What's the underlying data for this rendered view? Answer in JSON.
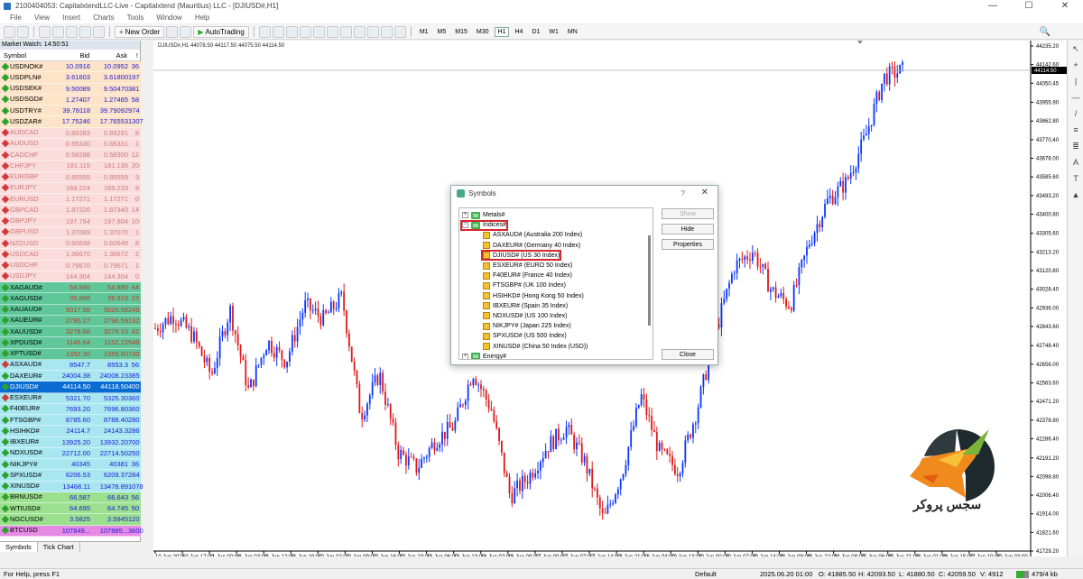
{
  "window": {
    "title": "2100404053: CapitalxtendLLC-Live - Capitalxtend (Mauritius) LLC - [DJIUSD#,H1]",
    "min": "—",
    "max": "☐",
    "close": "✕"
  },
  "menu": [
    "File",
    "View",
    "Insert",
    "Charts",
    "Tools",
    "Window",
    "Help"
  ],
  "toolbar": {
    "new_order": "New Order",
    "autotrading": "AutoTrading",
    "timeframes": [
      "M1",
      "M5",
      "M15",
      "M30",
      "H1",
      "H4",
      "D1",
      "W1",
      "MN"
    ],
    "active_timeframe": "H1"
  },
  "market_watch": {
    "title": "Market Watch: 14:50:51",
    "headers": {
      "symbol": "Symbol",
      "bid": "Bid",
      "ask": "Ask",
      "spread": "!"
    },
    "rows": [
      {
        "symbol": "USDNOK#",
        "bid": "10.0916",
        "ask": "10.0952",
        "spread": "36",
        "bg": "#fde3c8",
        "dir": "up",
        "faded": false
      },
      {
        "symbol": "USDPLN#",
        "bid": "3.61603",
        "ask": "3.61800",
        "spread": "197",
        "bg": "#fde3c8",
        "dir": "up",
        "faded": false
      },
      {
        "symbol": "USDSEK#",
        "bid": "9.50089",
        "ask": "9.50470",
        "spread": "381",
        "bg": "#fde3c8",
        "dir": "up",
        "faded": false
      },
      {
        "symbol": "USDSGD#",
        "bid": "1.27407",
        "ask": "1.27465",
        "spread": "58",
        "bg": "#fde3c8",
        "dir": "up",
        "faded": false
      },
      {
        "symbol": "USDTRY#",
        "bid": "39.78118",
        "ask": "39.79092",
        "spread": "974",
        "bg": "#fde3c8",
        "dir": "up",
        "faded": false
      },
      {
        "symbol": "USDZAR#",
        "bid": "17.75246",
        "ask": "17.76553",
        "spread": "1307",
        "bg": "#fde3c8",
        "dir": "up",
        "faded": false
      },
      {
        "symbol": "AUDCAD",
        "bid": "0.89283",
        "ask": "0.89291",
        "spread": "8",
        "bg": "#fbdcdc",
        "dir": "down",
        "faded": true
      },
      {
        "symbol": "AUDUSD",
        "bid": "0.65330",
        "ask": "0.65331",
        "spread": "1",
        "bg": "#fbdcdc",
        "dir": "down",
        "faded": true
      },
      {
        "symbol": "CADCHF",
        "bid": "0.58288",
        "ask": "0.58300",
        "spread": "12",
        "bg": "#fbdcdc",
        "dir": "down",
        "faded": true
      },
      {
        "symbol": "CHFJPY",
        "bid": "181.115",
        "ask": "181.135",
        "spread": "20",
        "bg": "#fbdcdc",
        "dir": "down",
        "faded": true
      },
      {
        "symbol": "EURGBP",
        "bid": "0.85556",
        "ask": "0.85559",
        "spread": "3",
        "bg": "#fbdcdc",
        "dir": "down",
        "faded": true
      },
      {
        "symbol": "EURJPY",
        "bid": "169.224",
        "ask": "169.233",
        "spread": "9",
        "bg": "#fbdcdc",
        "dir": "down",
        "faded": true
      },
      {
        "symbol": "EURUSD",
        "bid": "1.17271",
        "ask": "1.17271",
        "spread": "0",
        "bg": "#fbdcdc",
        "dir": "down",
        "faded": true
      },
      {
        "symbol": "GBPCAD",
        "bid": "1.87326",
        "ask": "1.87340",
        "spread": "14",
        "bg": "#fbdcdc",
        "dir": "down",
        "faded": true
      },
      {
        "symbol": "GBPJPY",
        "bid": "197.794",
        "ask": "197.804",
        "spread": "10",
        "bg": "#fbdcdc",
        "dir": "down",
        "faded": true
      },
      {
        "symbol": "GBPUSD",
        "bid": "1.37069",
        "ask": "1.37070",
        "spread": "1",
        "bg": "#fbdcdc",
        "dir": "down",
        "faded": true
      },
      {
        "symbol": "NZDUSD",
        "bid": "0.60638",
        "ask": "0.60646",
        "spread": "8",
        "bg": "#fbdcdc",
        "dir": "down",
        "faded": true
      },
      {
        "symbol": "USDCAD",
        "bid": "1.36670",
        "ask": "1.36672",
        "spread": "2",
        "bg": "#fbdcdc",
        "dir": "down",
        "faded": true
      },
      {
        "symbol": "USDCHF",
        "bid": "0.79670",
        "ask": "0.79671",
        "spread": "1",
        "bg": "#fbdcdc",
        "dir": "down",
        "faded": true
      },
      {
        "symbol": "USDJPY",
        "bid": "144.304",
        "ask": "144.304",
        "spread": "0",
        "bg": "#fbdcdc",
        "dir": "down",
        "faded": true
      },
      {
        "symbol": "XAGAUD#",
        "bid": "54.946",
        "ask": "54.990",
        "spread": "44",
        "bg": "#5fc79a",
        "dir": "up",
        "faded": false
      },
      {
        "symbol": "XAGUSD#",
        "bid": "35.896",
        "ask": "35.919",
        "spread": "23",
        "bg": "#5fc79a",
        "dir": "up",
        "faded": false
      },
      {
        "symbol": "XAUAUD#",
        "bid": "5017.58",
        "ask": "5020.06",
        "spread": "248",
        "bg": "#5fc79a",
        "dir": "up",
        "faded": false
      },
      {
        "symbol": "XAUEUR#",
        "bid": "2795.27",
        "ask": "2796.59",
        "spread": "132",
        "bg": "#5fc79a",
        "dir": "up",
        "faded": false
      },
      {
        "symbol": "XAUUSD#",
        "bid": "3278.68",
        "ask": "3279.10",
        "spread": "42",
        "bg": "#5fc79a",
        "dir": "up",
        "faded": false
      },
      {
        "symbol": "XPDUSD#",
        "bid": "1146.64",
        "ask": "1152.12",
        "spread": "548",
        "bg": "#5fc79a",
        "dir": "up",
        "faded": false
      },
      {
        "symbol": "XPTUSD#",
        "bid": "1352.30",
        "ask": "1359.60",
        "spread": "730",
        "bg": "#5fc79a",
        "dir": "up",
        "faded": false
      },
      {
        "symbol": "ASXAUD#",
        "bid": "8547.7",
        "ask": "8553.3",
        "spread": "56",
        "bg": "#a8e6f0",
        "dir": "down",
        "faded": false
      },
      {
        "symbol": "DAXEUR#",
        "bid": "24004.38",
        "ask": "24008.23",
        "spread": "385",
        "bg": "#a8e6f0",
        "dir": "up",
        "faded": false
      },
      {
        "symbol": "DJIUSD#",
        "bid": "44114.50",
        "ask": "44118.50",
        "spread": "400",
        "bg": "#0a6bd0",
        "dir": "up",
        "faded": false,
        "selected": true
      },
      {
        "symbol": "ESXEUR#",
        "bid": "5321.70",
        "ask": "5325.30",
        "spread": "360",
        "bg": "#a8e6f0",
        "dir": "down",
        "faded": false
      },
      {
        "symbol": "F40EUR#",
        "bid": "7693.20",
        "ask": "7696.80",
        "spread": "360",
        "bg": "#a8e6f0",
        "dir": "up",
        "faded": false
      },
      {
        "symbol": "FTSGBP#",
        "bid": "8785.60",
        "ask": "8788.40",
        "spread": "280",
        "bg": "#a8e6f0",
        "dir": "up",
        "faded": false
      },
      {
        "symbol": "HSIHKD#",
        "bid": "24114.7",
        "ask": "24143.3",
        "spread": "286",
        "bg": "#a8e6f0",
        "dir": "up",
        "faded": false
      },
      {
        "symbol": "IBXEUR#",
        "bid": "13925.20",
        "ask": "13932.20",
        "spread": "700",
        "bg": "#a8e6f0",
        "dir": "up",
        "faded": false
      },
      {
        "symbol": "NDXUSD#",
        "bid": "22712.00",
        "ask": "22714.50",
        "spread": "250",
        "bg": "#a8e6f0",
        "dir": "up",
        "faded": false
      },
      {
        "symbol": "NIKJPY#",
        "bid": "40345",
        "ask": "40381",
        "spread": "36",
        "bg": "#a8e6f0",
        "dir": "up",
        "faded": false
      },
      {
        "symbol": "SPXUSD#",
        "bid": "6206.53",
        "ask": "6209.37",
        "spread": "284",
        "bg": "#a8e6f0",
        "dir": "up",
        "faded": false
      },
      {
        "symbol": "XINUSD#",
        "bid": "13468.11",
        "ask": "13478.89",
        "spread": "1078",
        "bg": "#a8e6f0",
        "dir": "up",
        "faded": false
      },
      {
        "symbol": "BRNUSD#",
        "bid": "66.587",
        "ask": "66.643",
        "spread": "56",
        "bg": "#9be08f",
        "dir": "up",
        "faded": false
      },
      {
        "symbol": "WTIUSD#",
        "bid": "64.695",
        "ask": "64.745",
        "spread": "50",
        "bg": "#9be08f",
        "dir": "up",
        "faded": false
      },
      {
        "symbol": "NGCUSD#",
        "bid": "3.5825",
        "ask": "3.5945",
        "spread": "120",
        "bg": "#9be08f",
        "dir": "up",
        "faded": false
      },
      {
        "symbol": "BTCUSD",
        "bid": "107849...",
        "ask": "107885...",
        "spread": "3600",
        "bg": "#e78ae4",
        "dir": "up",
        "faded": false
      }
    ],
    "tabs": [
      "Symbols",
      "Tick Chart"
    ]
  },
  "chart": {
    "header": "DJIUSD#,H1  44078.50 44117.50 44075.50 44114.50",
    "current_price": "44114.50"
  },
  "chart_data": {
    "type": "candlestick",
    "symbol": "DJIUSD#",
    "timeframe": "H1",
    "ylim": [
      41729.2,
      44235.2
    ],
    "y_ticks": [
      "44235.20",
      "44142.60",
      "44050.45",
      "43955.90",
      "43862.80",
      "43770.40",
      "43678.00",
      "43585.60",
      "43493.20",
      "43400.80",
      "43305.60",
      "43213.20",
      "43120.80",
      "43028.40",
      "42936.00",
      "42843.60",
      "42748.40",
      "42656.00",
      "42563.60",
      "42471.20",
      "42378.80",
      "42286.40",
      "42191.20",
      "42098.80",
      "42006.40",
      "41914.00",
      "41821.60",
      "41729.20"
    ],
    "x_ticks": [
      "10 Jun 2025",
      "10 Jun 17:00",
      "11 Jun 00:00",
      "11 Jun 03:00",
      "11 Jun 12:00",
      "11 Jun 19:00",
      "12 Jun 02:00",
      "12 Jun 09:00",
      "12 Jun 16:00",
      "12 Jun 23:00",
      "13 Jun 06:00",
      "13 Jun 13:00",
      "16 Jun 02:00",
      "16 Jun 09:00",
      "17 Jun 00:00",
      "17 Jun 07:00",
      "17 Jun 14:00",
      "18 Jun 21:00",
      "18 Jun 04:00",
      "19 Jun 13:00",
      "20 Jun 00:00",
      "20 Jun 07:00",
      "20 Jun 14:00",
      "23 Jun 09:00",
      "23 Jun 22:00",
      "24 Jun 08:00",
      "25 Jun 06:00",
      "25 Jun 21:00",
      "26 Jun 01:00",
      "26 Jun 15:00",
      "27 Jun 10:00",
      "30 Jun 03:00"
    ],
    "anchors": [
      42835,
      42900,
      42800,
      42600,
      42930,
      42520,
      42770,
      42670,
      42950,
      42880,
      42990,
      42400,
      42610,
      42220,
      42140,
      42280,
      42350,
      42620,
      42430,
      42000,
      42100,
      42250,
      42340,
      42170,
      41880,
      42120,
      42500,
      42220,
      42130,
      42430,
      42820,
      43140,
      43220,
      43020,
      42950,
      43260,
      43470,
      43560,
      43780,
      44080,
      44115
    ],
    "series_colors": {
      "bull": "#0a35ff",
      "bear": "#e01818"
    }
  },
  "dialog": {
    "title": "Symbols",
    "help": "?",
    "close_x": "✕",
    "tree": [
      {
        "label": "Metals#",
        "type": "folder",
        "expanded": false,
        "highlight": false
      },
      {
        "label": "Indices#",
        "type": "folder",
        "expanded": true,
        "highlight": true
      },
      {
        "label": "ASXAUD#  (Australia 200 Index)",
        "type": "leaf",
        "highlight": false
      },
      {
        "label": "DAXEUR#  (Germany 40 Index)",
        "type": "leaf",
        "highlight": false
      },
      {
        "label": "DJIUSD#  (US 30 Index)",
        "type": "leaf",
        "highlight": true
      },
      {
        "label": "ESXEUR#  (EURO 50 Index)",
        "type": "leaf",
        "highlight": false
      },
      {
        "label": "F40EUR#  (France 40 Index)",
        "type": "leaf",
        "highlight": false
      },
      {
        "label": "FTSGBP#  (UK 100 Index)",
        "type": "leaf",
        "highlight": false
      },
      {
        "label": "HSIHKD#  (Hong Kong 50 Index)",
        "type": "leaf",
        "highlight": false
      },
      {
        "label": "IBXEUR#  (Spain 35 Index)",
        "type": "leaf",
        "highlight": false
      },
      {
        "label": "NDXUSD#  (US 100 Index)",
        "type": "leaf",
        "highlight": false
      },
      {
        "label": "NIKJPY#  (Japan 225 Index)",
        "type": "leaf",
        "highlight": false
      },
      {
        "label": "SPXUSD#  (US 500 Index)",
        "type": "leaf",
        "highlight": false
      },
      {
        "label": "XINUSD#  (China 50 Index (USD))",
        "type": "leaf",
        "highlight": false
      },
      {
        "label": "Energy#",
        "type": "folder",
        "expanded": false,
        "highlight": false
      }
    ],
    "buttons": {
      "show": "Show",
      "hide": "Hide",
      "properties": "Properties",
      "close": "Close"
    }
  },
  "logo": {
    "text": "سجس پروکر"
  },
  "statusbar": {
    "help": "For Help, press F1",
    "profile": "Default",
    "datetime": "2025.06.20 01:00",
    "open": "O: 41885.50",
    "high": "H: 42093.50",
    "low": "L: 41880.50",
    "close": "C: 42059.50",
    "volume": "V: 4912",
    "traffic": "479/4 kb"
  }
}
